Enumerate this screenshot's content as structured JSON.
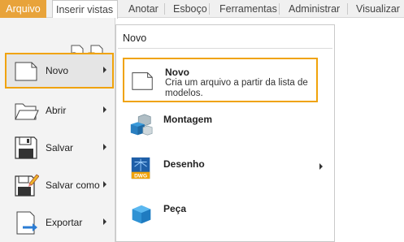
{
  "tabs": [
    {
      "label": "Arquivo"
    },
    {
      "label": "Inserir vistas"
    },
    {
      "label": "Anotar"
    },
    {
      "label": "Esboço"
    },
    {
      "label": "Ferramentas"
    },
    {
      "label": "Administrar"
    },
    {
      "label": "Visualizar"
    }
  ],
  "left_menu": [
    {
      "label": "Novo",
      "icon": "new-document-icon"
    },
    {
      "label": "Abrir",
      "icon": "open-folder-icon"
    },
    {
      "label": "Salvar",
      "icon": "save-floppy-icon"
    },
    {
      "label": "Salvar como",
      "icon": "save-as-icon"
    },
    {
      "label": "Exportar",
      "icon": "export-icon"
    }
  ],
  "submenu": {
    "header": "Novo",
    "items": [
      {
        "title": "Novo",
        "desc": "Cria um arquivo a partir da lista de modelos.",
        "icon": "new-document-icon"
      },
      {
        "title": "Montagem",
        "icon": "assembly-icon"
      },
      {
        "title": "Desenho",
        "icon": "drawing-dwg-icon",
        "badge": "DWG"
      },
      {
        "title": "Peça",
        "icon": "part-cube-icon"
      }
    ]
  },
  "colors": {
    "accent": "#f0a30a",
    "file_tab": "#e8a33a",
    "part_blue": "#3b9ad9"
  }
}
